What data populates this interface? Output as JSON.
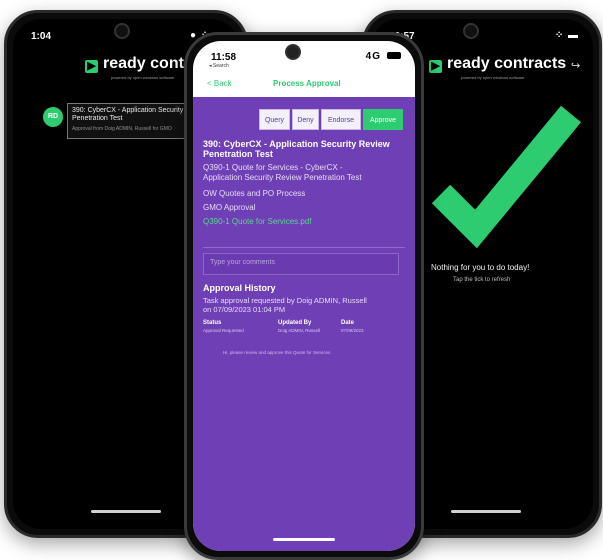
{
  "brand": {
    "name": "ready contracts",
    "tagline": "powered by open windows software",
    "mark": "▶"
  },
  "left_phone": {
    "time": "1:04",
    "status_icons": "● ⁘ ▬",
    "task": {
      "avatar": "RD",
      "title_line1": "390: CyberCX - Application Security R",
      "title_line2": "Penetration Test",
      "subtitle": "Approval from Doig ADMIN, Russell for GMO"
    }
  },
  "center_phone": {
    "time": "11:58",
    "network": "4G",
    "back_app": "◂ Search",
    "nav": {
      "back_label": "< Back",
      "title": "Process Approval"
    },
    "actions": [
      "Query",
      "Deny",
      "Endorse",
      "Approve"
    ],
    "title_line1": "390: CyberCX - Application Security Review",
    "title_line2": "Penetration Test",
    "desc_line1": "Q390-1 Quote for Services - CyberCX -",
    "desc_line2": "Application Security Review Penetration Test",
    "process": "OW Quotes and PO Process",
    "stage": "GMO Approval",
    "link": "Q390-1 Quote for Services.pdf",
    "comment_placeholder": "Type your comments",
    "history": {
      "heading": "Approval History",
      "entry_line1": "Task approval requested by Doig ADMIN, Russell",
      "entry_line2": "on 07/09/2023 01:04 PM",
      "columns": [
        "Status",
        "Updated By",
        "Date"
      ],
      "row": [
        "Approval Requested",
        "Doig ADMIN, Russell",
        "07/09/2023"
      ],
      "note": "Hi, please review and approve this Quote for Services"
    }
  },
  "right_phone": {
    "time": "12:57",
    "status_icons": "⁘ ▬",
    "empty_title": "Nothing for you to do today!",
    "empty_hint": "Tap the tick to refresh",
    "logout_icon": "↪",
    "tick_color": "#2ecc71"
  }
}
